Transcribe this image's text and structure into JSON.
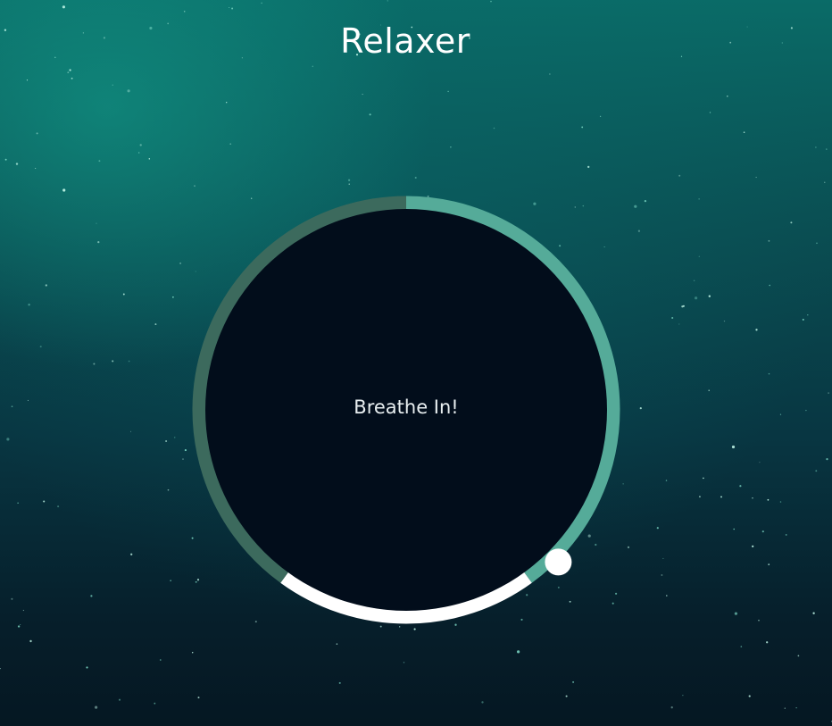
{
  "app": {
    "title": "Relaxer"
  },
  "breathing": {
    "instruction": "Breathe In!",
    "segments": [
      {
        "phase": "breathe-in",
        "color": "#55ab99"
      },
      {
        "phase": "hold",
        "color": "#ffffff"
      },
      {
        "phase": "breathe-out",
        "color": "#3c6a5d"
      }
    ]
  },
  "colors": {
    "circle_fill": "#020d1b",
    "pointer": "#ffffff",
    "title": "#ffffff"
  }
}
